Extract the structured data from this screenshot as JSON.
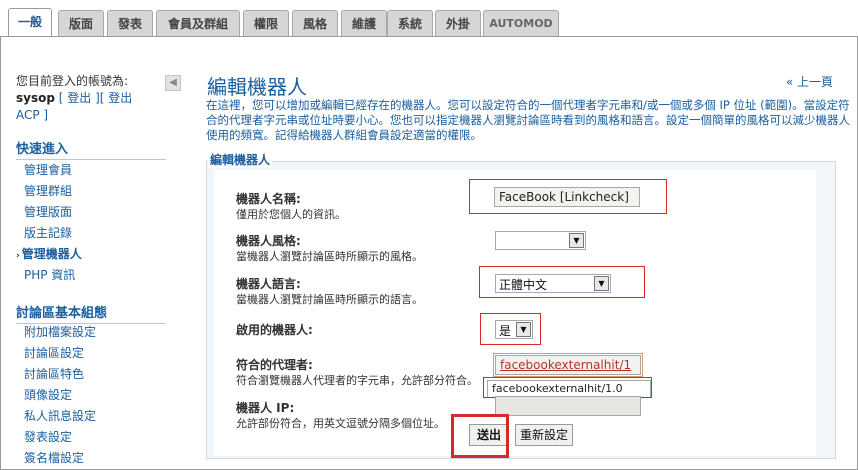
{
  "tabs": [
    {
      "label": "一般",
      "active": true
    },
    {
      "label": "版面",
      "active": false
    },
    {
      "label": "發表",
      "active": false
    },
    {
      "label": "會員及群組",
      "active": false
    },
    {
      "label": "權限",
      "active": false
    },
    {
      "label": "風格",
      "active": false
    },
    {
      "label": "維護",
      "active": false
    },
    {
      "label": "系統",
      "active": false
    },
    {
      "label": "外掛",
      "active": false
    },
    {
      "label": "AUTOMOD",
      "active": false
    }
  ],
  "sidebar": {
    "login_prefix": "您目前登入的帳號為:",
    "username": "sysop",
    "logout_link": "[ 登出 ]",
    "acp_logout_link": "[ 登出 ACP ]",
    "collapse_icon": "◀",
    "quick_access_title": "快速進入",
    "quick_access_items": [
      {
        "label": "管理會員",
        "active": false
      },
      {
        "label": "管理群組",
        "active": false
      },
      {
        "label": "管理版面",
        "active": false
      },
      {
        "label": "版主記錄",
        "active": false
      },
      {
        "label": "管理機器人",
        "active": true
      },
      {
        "label": "PHP 資訊",
        "active": false
      }
    ],
    "forum_basic_title": "討論區基本組態",
    "forum_basic_items": [
      {
        "label": "附加檔案設定"
      },
      {
        "label": "討論區設定"
      },
      {
        "label": "討論區特色"
      },
      {
        "label": "頭像設定"
      },
      {
        "label": "私人訊息設定"
      },
      {
        "label": "發表設定"
      },
      {
        "label": "簽名檔設定"
      }
    ]
  },
  "main": {
    "title": "編輯機器人",
    "back_link": "« 上一頁",
    "description": "在這裡，您可以增加或編輯已經存在的機器人。您可以設定符合的一個代理者字元串和/或一個或多個 IP 位址 (範圍)。當設定符合的代理者字元串或位址時要小心。您也可以指定機器人瀏覽討論區時看到的風格和語言。設定一個簡單的風格可以減少機器人使用的頻寬。記得給機器人群組會員設定適當的權限。",
    "legend": "編輯機器人",
    "fields": {
      "bot_name": {
        "label": "機器人名稱:",
        "hint": "僅用於您個人的資訊。",
        "value": "FaceBook [Linkcheck]"
      },
      "bot_style": {
        "label": "機器人風格:",
        "hint": "當機器人瀏覽討論區時所顯示的風格。",
        "value": ""
      },
      "bot_lang": {
        "label": "機器人語言:",
        "hint": "當機器人瀏覽討論區時所顯示的語言。",
        "value": "正體中文"
      },
      "bot_active": {
        "label": "啟用的機器人:",
        "value": "是"
      },
      "bot_agent": {
        "label": "符合的代理者:",
        "hint": "符合瀏覽機器人代理者的字元串，允許部分符合。",
        "value": "facebookexternalhit/1",
        "typed_value": "facebookexternalhit/1.0"
      },
      "bot_ip": {
        "label": "機器人 IP:",
        "hint": "允許部份符合，用英文逗號分隔多個位址。",
        "value": ""
      }
    },
    "submit_label": "送出",
    "reset_label": "重新設定"
  },
  "colors": {
    "accent": "#1b5fa0",
    "highlight": "#d42a2a"
  }
}
